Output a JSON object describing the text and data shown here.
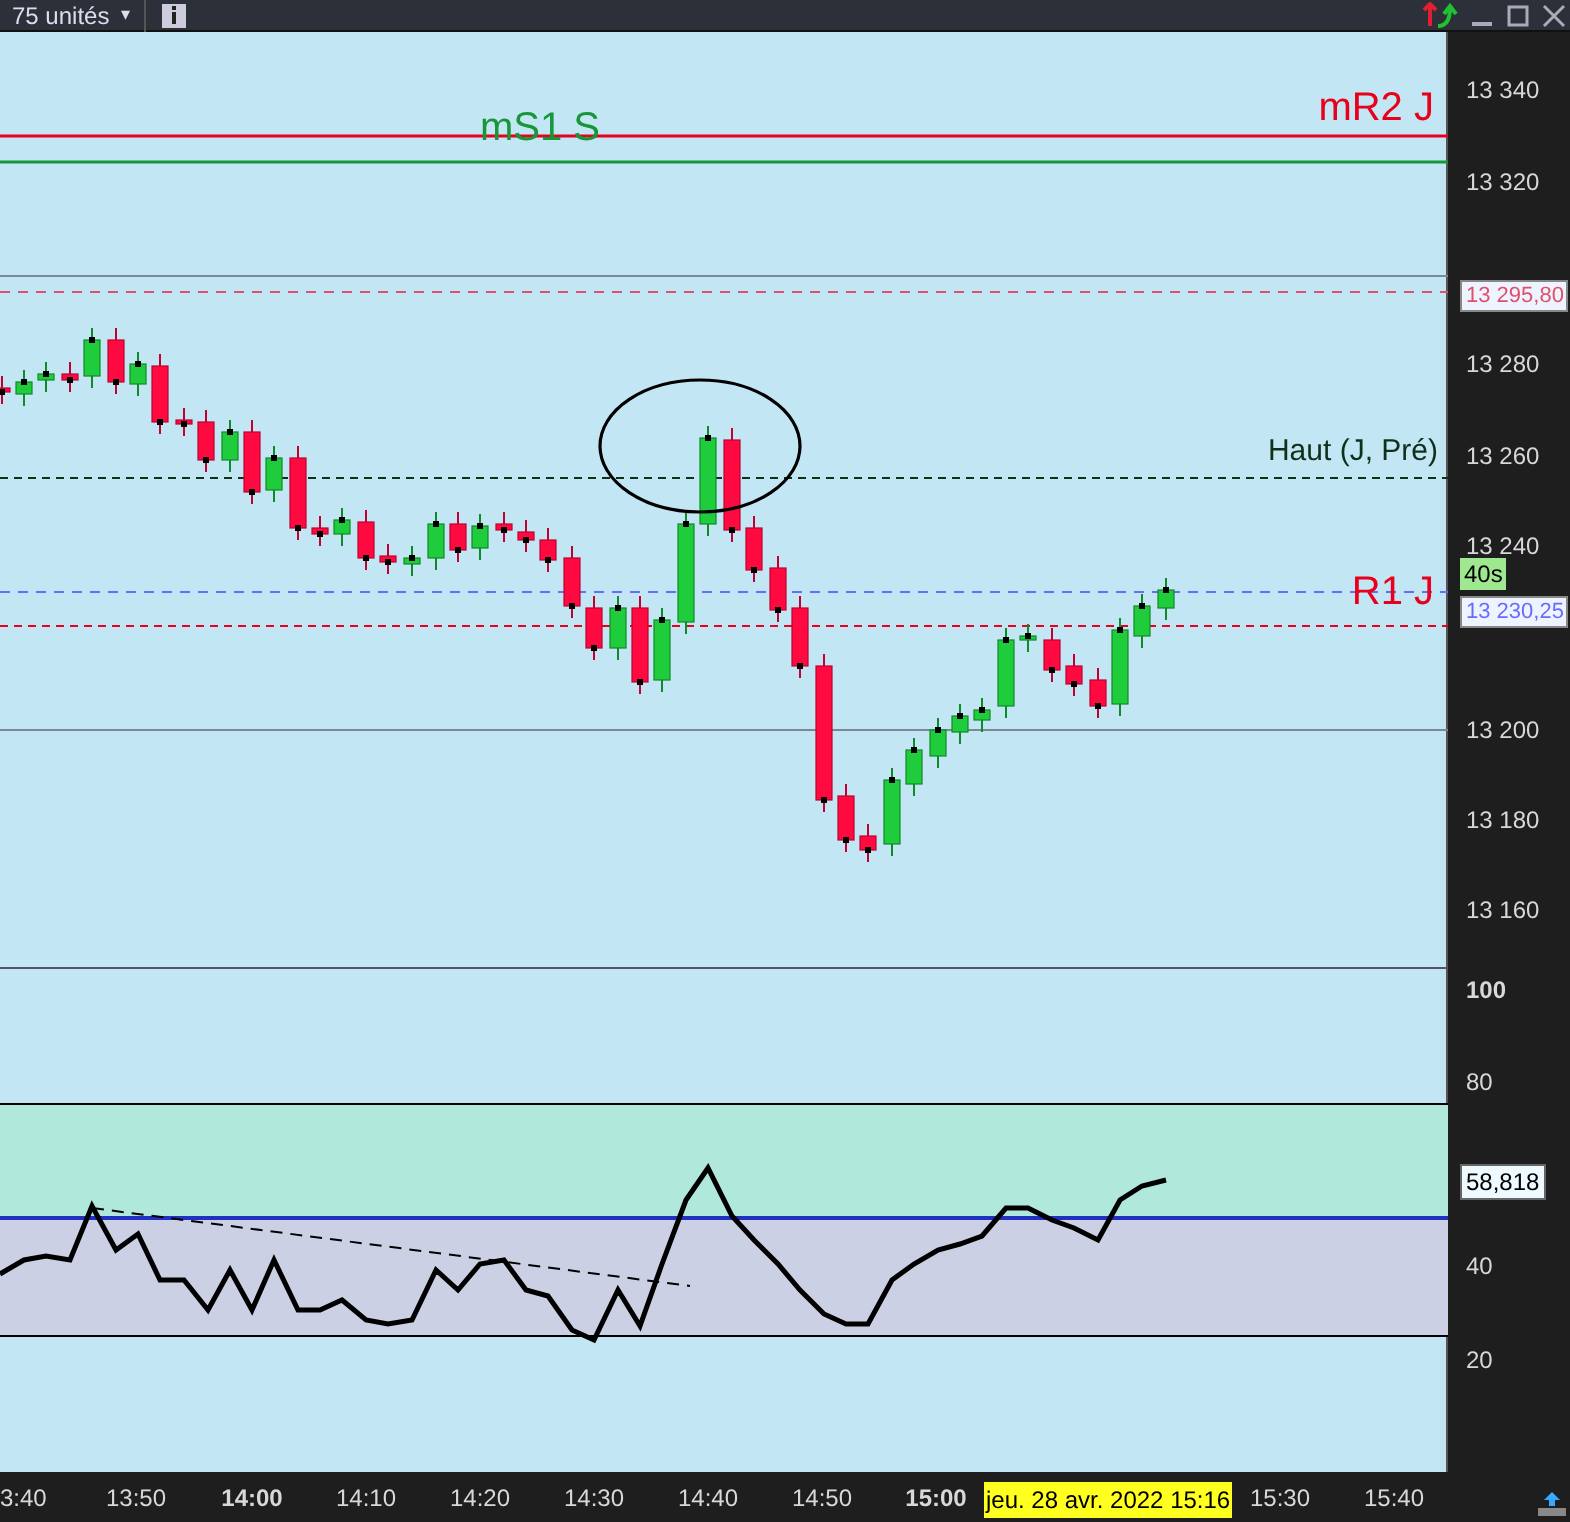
{
  "toolbar": {
    "units_label": "75 unités",
    "caret": "▾"
  },
  "price_levels": [
    {
      "label": "mR2 J",
      "color": "#e8001c",
      "kind": "solid"
    },
    {
      "label": "mS1 S",
      "color": "#17963a",
      "kind": "solid"
    },
    {
      "label": "Haut (J, Pré)",
      "color": "#10301a",
      "kind": "dashed"
    },
    {
      "label": "R1 J",
      "color": "#e8001c",
      "kind": "dashed"
    }
  ],
  "price_axis": [
    "13 340",
    "13 320",
    "13 280",
    "13 260",
    "13 240",
    "13 200",
    "13 180",
    "13 160"
  ],
  "price_tags": [
    {
      "kind": "price",
      "text": "13 295,80",
      "color": "#e0506a"
    },
    {
      "kind": "timer",
      "text": "40s"
    },
    {
      "kind": "price",
      "text": "13 230,25",
      "color": "#6a6aff"
    }
  ],
  "oscillator": {
    "axis": [
      "100",
      "80",
      "40",
      "20"
    ],
    "value_tag": "58,818"
  },
  "time_axis": [
    {
      "text": "3:40",
      "bold": false
    },
    {
      "text": "13:50",
      "bold": false
    },
    {
      "text": "14:00",
      "bold": true
    },
    {
      "text": "14:10",
      "bold": false
    },
    {
      "text": "14:20",
      "bold": false
    },
    {
      "text": "14:30",
      "bold": false
    },
    {
      "text": "14:40",
      "bold": false
    },
    {
      "text": "14:50",
      "bold": false
    },
    {
      "text": "15:00",
      "bold": true
    },
    {
      "text": "15:30",
      "bold": false
    },
    {
      "text": "15:40",
      "bold": false
    }
  ],
  "cursor_date": "jeu. 28 avr. 2022 15:16"
}
